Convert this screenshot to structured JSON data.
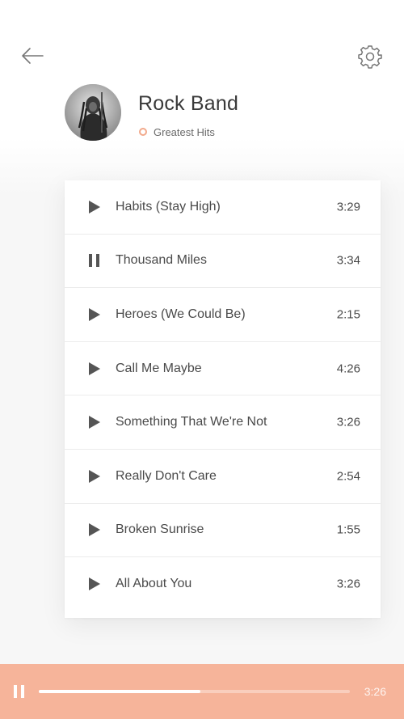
{
  "header": {
    "back_icon": "arrow-left-icon",
    "settings_icon": "gear-icon"
  },
  "artist": {
    "name": "Rock Band",
    "album": "Greatest Hits",
    "avatar": "avatar-photo"
  },
  "colors": {
    "accent": "#f6b49a",
    "album_dot": "#f2a98b",
    "text": "#4a4a4a",
    "icon": "#555555"
  },
  "tracks": [
    {
      "title": "Habits (Stay High)",
      "duration": "3:29",
      "state": "play"
    },
    {
      "title": "Thousand Miles",
      "duration": "3:34",
      "state": "pause"
    },
    {
      "title": "Heroes (We Could Be)",
      "duration": "2:15",
      "state": "play"
    },
    {
      "title": "Call Me Maybe",
      "duration": "4:26",
      "state": "play"
    },
    {
      "title": "Something That We're Not",
      "duration": "3:26",
      "state": "play"
    },
    {
      "title": "Really Don't Care",
      "duration": "2:54",
      "state": "play"
    },
    {
      "title": "Broken Sunrise",
      "duration": "1:55",
      "state": "play"
    },
    {
      "title": "All About You",
      "duration": "3:26",
      "state": "play"
    }
  ],
  "player": {
    "state_icon": "pause-icon",
    "progress": 0.52,
    "time": "3:26"
  }
}
